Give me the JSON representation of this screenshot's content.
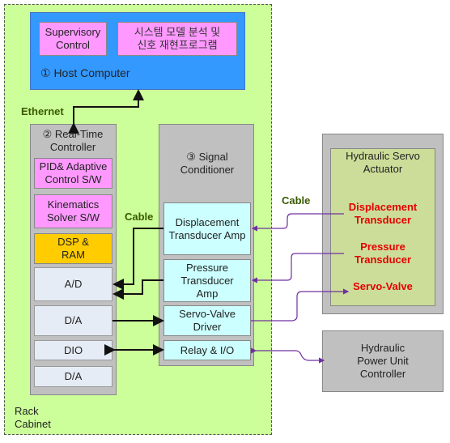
{
  "rack": {
    "label": "Rack\nCabinet"
  },
  "host": {
    "label": "① Host Computer",
    "supervisory": "Supervisory Control",
    "korean": "시스템 모델 분석 및 신호 재현프로그램"
  },
  "ethernet": "Ethernet",
  "rtc": {
    "label": "② Real-Time Controller",
    "items": [
      "PID& Adaptive Control S/W",
      "Kinematics Solver S/W",
      "DSP & RAM",
      "A/D",
      "D/A",
      "DIO",
      "D/A"
    ]
  },
  "signal": {
    "label": "③  Signal Conditioner",
    "items": [
      "Displacement Transducer Amp",
      "Pressure Transducer Amp",
      "Servo-Valve Driver",
      "Relay & I/O"
    ]
  },
  "cable_left": "Cable",
  "cable_right": "Cable",
  "actuator": {
    "label": "Hydraulic Servo Actuator",
    "items": [
      "Displacement Transducer",
      "Pressure Transducer",
      "Servo-Valve"
    ]
  },
  "power": {
    "label": "Hydraulic Power Unit Controller"
  },
  "colors": {
    "rack": "#ccff99",
    "host": "#3399ff",
    "software": "#ff99ff",
    "dsp": "#ffcc00",
    "conditioner": "#ccffff",
    "sensor_text": "#e60000",
    "cable": "#7030a0"
  }
}
